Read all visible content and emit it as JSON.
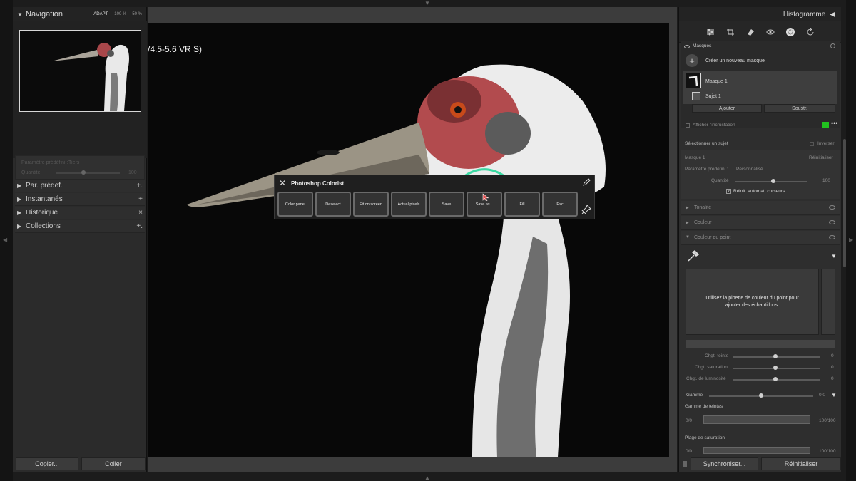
{
  "left_panel": {
    "navigation": {
      "title": "Navigation",
      "opt_fit": "ADAPT.",
      "opt_100": "100 %",
      "opt_50": "50 %"
    },
    "presets_faint": {
      "label": "Paramètre prédéfini :",
      "value": "Tiers",
      "amount_label": "Quantité",
      "amount_value": "100"
    },
    "sections": [
      {
        "label": "Par. prédef.",
        "action": "+."
      },
      {
        "label": "Instantanés",
        "action": "+"
      },
      {
        "label": "Historique",
        "action": "×"
      },
      {
        "label": "Collections",
        "action": "+."
      }
    ],
    "copy_button": "Copier...",
    "paste_button": "Coller"
  },
  "photo": {
    "lens_text": "/4.5-5.6 VR S)"
  },
  "colorist": {
    "title": "Photoshop Colorist",
    "buttons": [
      "Color panel",
      "Deselect",
      "Fit on screen",
      "Actual pixels",
      "Save",
      "Save as...",
      "Fill",
      "Esc"
    ]
  },
  "right_panel": {
    "histogram_title": "Histogramme",
    "masks_label": "Masques",
    "create_mask": "Créer un nouveau masque",
    "mask_1": "Masque 1",
    "subject_1": "Sujet 1",
    "add_button": "Ajouter",
    "subtract_button": "Soustr.",
    "show_overlay": "Afficher l'incrustation",
    "select_subject": "Sélectionner un sujet",
    "invert": "Inverser",
    "mask_name": "Masque 1",
    "reset": "Réinitialiser",
    "preset_label": "Paramètre prédéfini :",
    "preset_value": "Personnalisé",
    "amount_label": "Quantité",
    "amount_value": "100",
    "auto_reset": "Réinit. automat. curseurs",
    "tonality": "Tonalité",
    "color": "Couleur",
    "point_color": "Couleur du point",
    "point_hint": "Utilisez la pipette de couleur du point pour ajouter des échantillons.",
    "hue_shift": "Chgt. teinte",
    "sat_shift": "Chgt. saturation",
    "lum_shift": "Chgt. de luminosité",
    "shift_value": "0",
    "range": "Gamme",
    "range_value": "0,0",
    "hue_range": "Gamme de teintes",
    "range_min": "0/0",
    "range_max": "100/100",
    "sat_range": "Plage de saturation",
    "sync_button": "Synchroniser...",
    "reset_button": "Réinitialiser"
  }
}
